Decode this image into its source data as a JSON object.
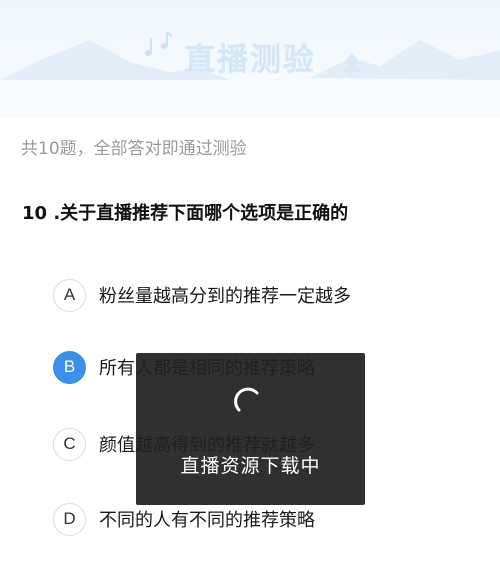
{
  "banner": {
    "title": "直播测验"
  },
  "quiz": {
    "subtitle": "共10题，全部答对即通过测验",
    "question": "10 .关于直播推荐下面哪个选项是正确的",
    "options": [
      {
        "letter": "A",
        "text": "粉丝量越高分到的推荐一定越多",
        "selected": false
      },
      {
        "letter": "B",
        "text": "所有人都是相同的推荐策略",
        "selected": true
      },
      {
        "letter": "C",
        "text": "颜值越高得到的推荐就越多",
        "selected": false
      },
      {
        "letter": "D",
        "text": "不同的人有不同的推荐策略",
        "selected": false
      }
    ]
  },
  "loading": {
    "text": "直播资源下载中",
    "icon": "spinner-icon"
  },
  "colors": {
    "accent": "#3d8fe8",
    "overlay": "#202020",
    "banner_title": "#d6e7f7"
  }
}
